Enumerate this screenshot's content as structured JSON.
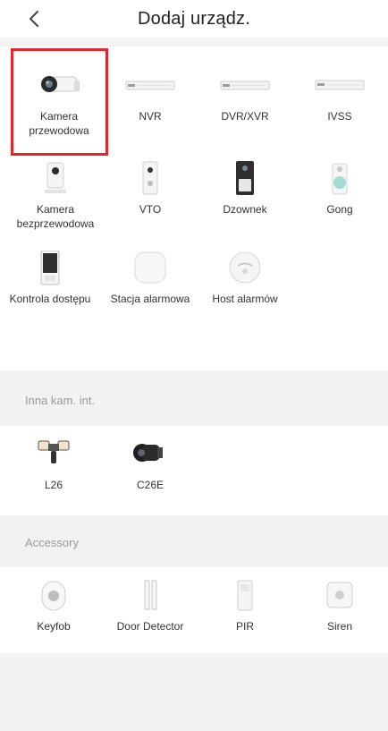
{
  "header": {
    "title": "Dodaj urządz.",
    "back_icon": "chevron-left-icon"
  },
  "devices": [
    {
      "label": "Kamera przewodowa",
      "icon": "bullet-camera-icon",
      "selected": true
    },
    {
      "label": "NVR",
      "icon": "nvr-recorder-icon"
    },
    {
      "label": "DVR/XVR",
      "icon": "dvr-recorder-icon"
    },
    {
      "label": "IVSS",
      "icon": "ivss-recorder-icon"
    },
    {
      "label": "Kamera bezprzewodowa",
      "icon": "wireless-camera-icon"
    },
    {
      "label": "VTO",
      "icon": "vto-intercom-icon"
    },
    {
      "label": "Dzownek",
      "icon": "doorbell-icon"
    },
    {
      "label": "Gong",
      "icon": "chime-icon"
    },
    {
      "label": "Kontrola dostępu",
      "icon": "access-control-icon"
    },
    {
      "label": "Stacja alarmowa",
      "icon": "alarm-station-icon"
    },
    {
      "label": "Host alarmów",
      "icon": "alarm-host-icon"
    }
  ],
  "other_cameras": {
    "title": "Inna kam. int.",
    "items": [
      {
        "label": "L26",
        "icon": "floodlight-camera-icon"
      },
      {
        "label": "C26E",
        "icon": "black-bullet-camera-icon"
      }
    ]
  },
  "accessory": {
    "title": "Accessory",
    "items": [
      {
        "label": "Keyfob",
        "icon": "keyfob-icon"
      },
      {
        "label": "Door Detector",
        "icon": "door-detector-icon"
      },
      {
        "label": "PIR",
        "icon": "pir-sensor-icon"
      },
      {
        "label": "Siren",
        "icon": "siren-icon"
      }
    ]
  },
  "colors": {
    "selection": "#e3262c",
    "section_bg": "#f2f2f2",
    "section_title": "#9a9a9a"
  }
}
